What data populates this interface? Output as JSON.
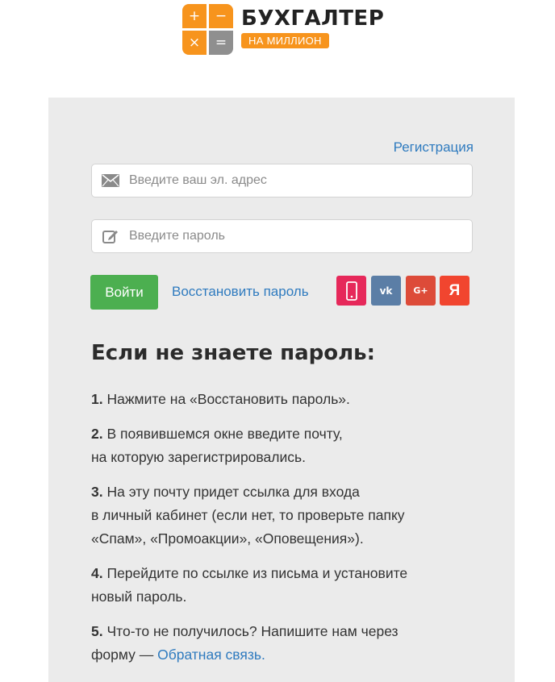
{
  "logo": {
    "grid": [
      "+",
      "−",
      "×",
      "="
    ],
    "title": "БУХГАЛТЕР",
    "subtitle": "НА МИЛЛИОН"
  },
  "form": {
    "register_link": "Регистрация",
    "email_placeholder": "Введите ваш эл. адрес",
    "password_placeholder": "Введите пароль",
    "login_button": "Войти",
    "restore_link": "Восстановить пароль",
    "social": {
      "vk": "vk",
      "gplus": "G+",
      "yandex": "Я"
    }
  },
  "help": {
    "title": "Если не знаете пароль:",
    "steps": [
      {
        "num": "1.",
        "lines": [
          "Нажмите на «Восстановить пароль»."
        ]
      },
      {
        "num": "2.",
        "lines": [
          "В появившемся окне введите почту,",
          "на которую зарегистрировались."
        ]
      },
      {
        "num": "3.",
        "lines": [
          "На эту почту придет ссылка для входа",
          "в личный кабинет (если нет, то проверьте папку",
          "«Спам», «Промоакции», «Оповещения»)."
        ]
      },
      {
        "num": "4.",
        "lines": [
          "Перейдите по ссылке из письма и установите",
          "новый пароль."
        ]
      },
      {
        "num": "5.",
        "lines": [
          "Что-то не получилось? Напишите нам через",
          "форму — "
        ],
        "link": "Обратная связь."
      }
    ]
  },
  "colors": {
    "brand_orange": "#f7941d",
    "login_green": "#4caf50",
    "link_blue": "#2f7bbf",
    "card_bg": "#ebebeb"
  }
}
